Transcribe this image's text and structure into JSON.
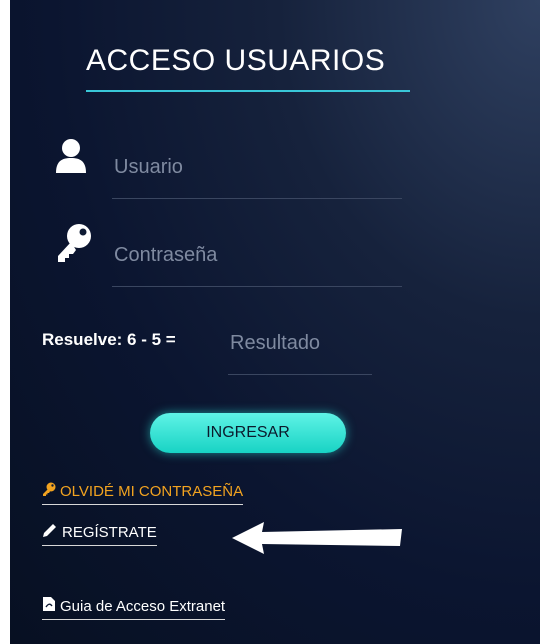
{
  "login": {
    "title": "ACCESO USUARIOS",
    "username_placeholder": "Usuario",
    "password_placeholder": "Contraseña",
    "captcha_label": "Resuelve: 6 - 5 =",
    "result_placeholder": "Resultado",
    "submit_label": "INGRESAR",
    "forgot_label": "OLVIDÉ MI CONTRASEÑA",
    "register_label": "REGÍSTRATE",
    "guide_label": "Guia de Acceso Extranet"
  },
  "colors": {
    "accent": "#1fd8c8",
    "title_underline": "#39c7d8",
    "forgot_link": "#f2a320"
  },
  "icons": [
    "user-icon",
    "key-icon",
    "key-small-icon",
    "pencil-icon",
    "pdf-icon",
    "arrow-left-icon"
  ]
}
